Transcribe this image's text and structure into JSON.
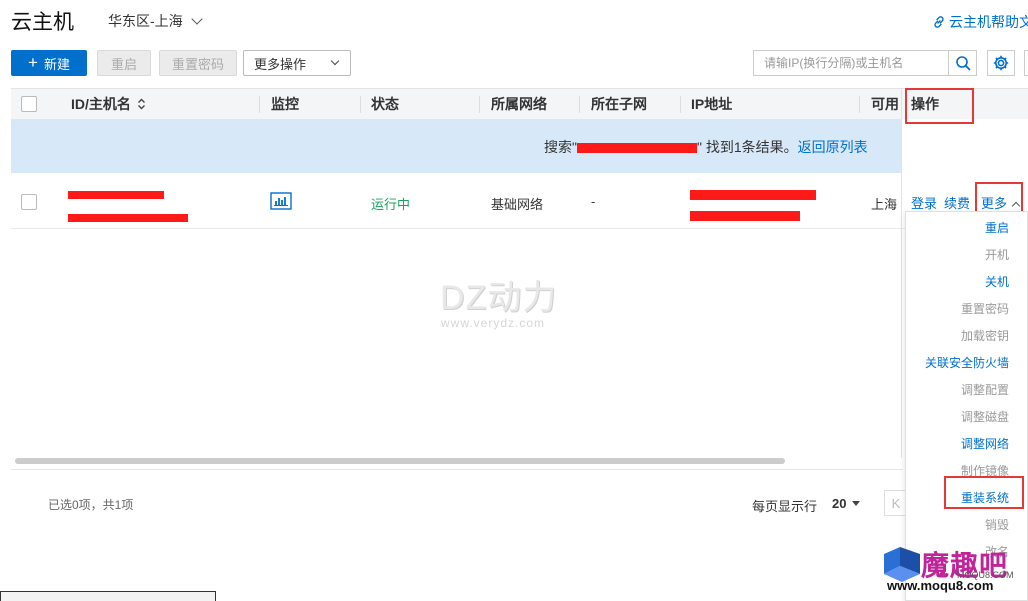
{
  "header": {
    "title": "云主机",
    "region": "华东区-上海",
    "help_link": "云主机帮助文"
  },
  "toolbar": {
    "new_label": "新建",
    "restart_label": "重启",
    "reset_password_label": "重置密码",
    "more_label": "更多操作",
    "search_placeholder": "请输IP(换行分隔)或主机名"
  },
  "table": {
    "columns": [
      "ID/主机名",
      "监控",
      "状态",
      "所属网络",
      "所在子网",
      "IP地址",
      "可用",
      "操作"
    ],
    "notice": {
      "prefix": "搜索\"",
      "suffix": "\" 找到1条结果。",
      "back_link": "返回原列表"
    },
    "rows": [
      {
        "status": "运行中",
        "network": "基础网络",
        "subnet": "-",
        "zone": "上海",
        "actions": {
          "login": "登录",
          "renew": "续费",
          "more": "更多"
        }
      }
    ]
  },
  "footer": {
    "selection_info": "已选0项，共1项",
    "per_page_label": "每页显示行",
    "per_page_value": "20",
    "first_page": "K"
  },
  "more_menu": {
    "items": [
      {
        "label": "重启",
        "state": "enabled"
      },
      {
        "label": "开机",
        "state": "disabled"
      },
      {
        "label": "关机",
        "state": "enabled"
      },
      {
        "label": "重置密码",
        "state": "disabled"
      },
      {
        "label": "加载密钥",
        "state": "disabled"
      },
      {
        "label": "关联安全防火墙",
        "state": "enabled"
      },
      {
        "label": "调整配置",
        "state": "disabled"
      },
      {
        "label": "调整磁盘",
        "state": "disabled"
      },
      {
        "label": "调整网络",
        "state": "enabled"
      },
      {
        "label": "制作镜像",
        "state": "disabled"
      },
      {
        "label": "重装系统",
        "state": "enabled"
      },
      {
        "label": "销毁",
        "state": "disabled"
      },
      {
        "label": "改名",
        "state": "disabled"
      }
    ]
  },
  "watermark": {
    "main": "DZ动力",
    "sub": "www.verydz.com",
    "logo_text": "魔趣吧",
    "logo_sub": "MOQU8.COM",
    "logo_url": "www.moqu8.com"
  },
  "colors": {
    "primary": "#0070cc",
    "running": "#1aa260",
    "highlight": "#e53935",
    "redaction": "#ff1a1a",
    "notice_bg": "#d7e8f8"
  }
}
